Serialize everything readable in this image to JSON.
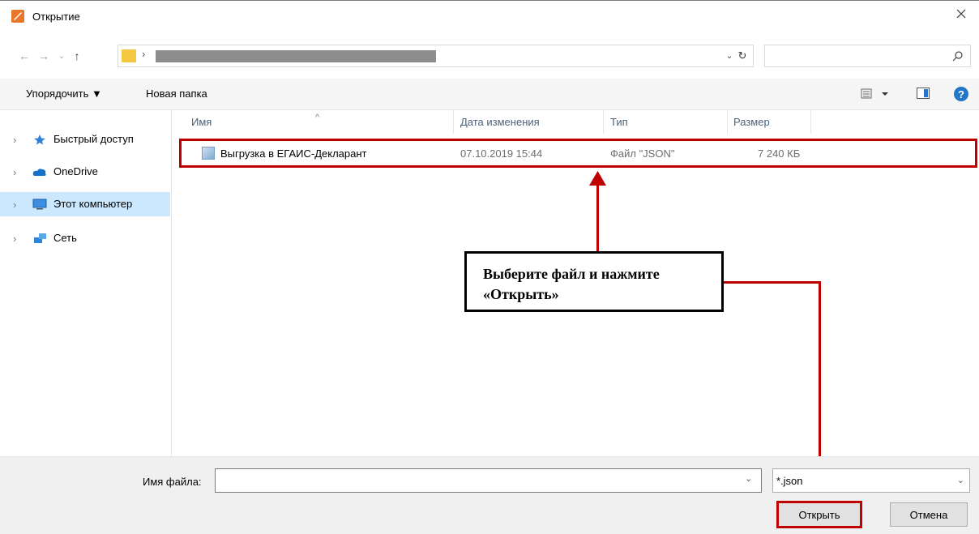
{
  "window": {
    "title": "Открытие"
  },
  "address": {
    "redacted_path": true
  },
  "toolbar": {
    "organize_label": "Упорядочить ▼",
    "new_folder_label": "Новая папка"
  },
  "nav": [
    {
      "label": "Быстрый доступ",
      "icon": "star-icon"
    },
    {
      "label": "OneDrive",
      "icon": "cloud-icon"
    },
    {
      "label": "Этот компьютер",
      "icon": "computer-icon",
      "selected": true
    },
    {
      "label": "Сеть",
      "icon": "network-icon"
    }
  ],
  "columns": {
    "name": "Имя",
    "date": "Дата изменения",
    "type": "Тип",
    "size": "Размер"
  },
  "files": [
    {
      "name": "Выгрузка в ЕГАИС-Декларант",
      "date": "07.10.2019 15:44",
      "type": "Файл \"JSON\"",
      "size": "7 240 КБ"
    }
  ],
  "annotation": {
    "line1": "Выберите файл и нажмите",
    "line2": "«Открыть»"
  },
  "footer": {
    "filename_label": "Имя файла:",
    "filename_value": "",
    "filter_value": "*.json",
    "open_label": "Открыть",
    "cancel_label": "Отмена"
  },
  "colors": {
    "highlight": "#c00000",
    "selection": "#cce8ff",
    "accent": "#2375c5"
  }
}
